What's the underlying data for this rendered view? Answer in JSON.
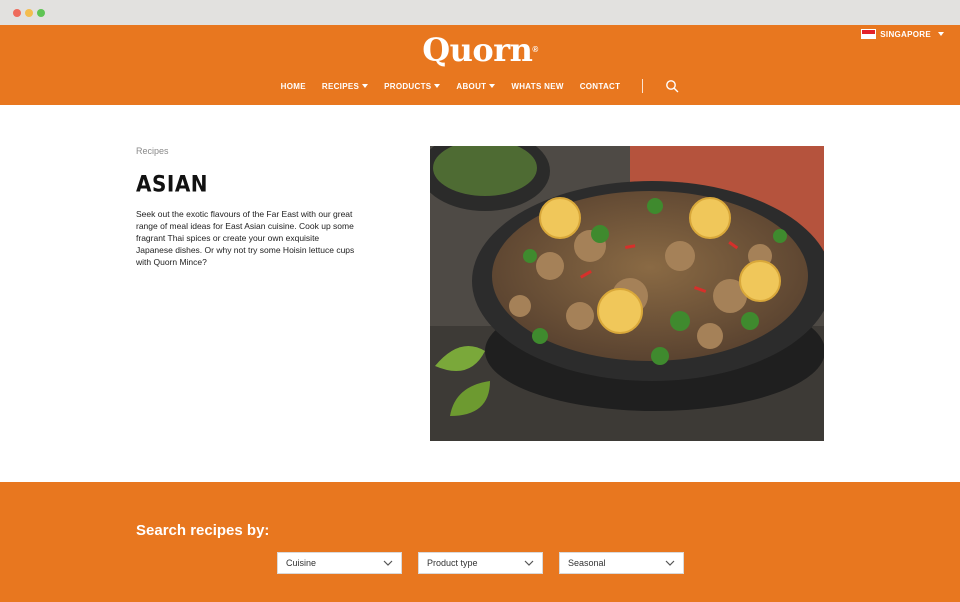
{
  "header": {
    "logo_text": "Quorn",
    "region_label": "SINGAPORE",
    "nav": [
      {
        "label": "HOME",
        "has_dropdown": false
      },
      {
        "label": "RECIPES",
        "has_dropdown": true
      },
      {
        "label": "PRODUCTS",
        "has_dropdown": true
      },
      {
        "label": "ABOUT",
        "has_dropdown": true
      },
      {
        "label": "WHATS NEW",
        "has_dropdown": false
      },
      {
        "label": "CONTACT",
        "has_dropdown": false
      }
    ],
    "search_icon": "search-icon"
  },
  "main": {
    "breadcrumb": "Recipes",
    "title": "ASIAN",
    "description": "Seek out the exotic flavours of the Far East with our great range of meal ideas for East Asian cuisine. Cook up some fragrant Thai spices or create your own exquisite Japanese dishes. Or why not try some Hoisin lettuce cups with Quorn Mince?"
  },
  "search": {
    "heading": "Search recipes by:",
    "filters": [
      {
        "label": "Cuisine"
      },
      {
        "label": "Product type"
      },
      {
        "label": "Seasonal"
      }
    ]
  },
  "colors": {
    "brand_orange": "#e8771f",
    "flag_red": "#e3222a"
  }
}
